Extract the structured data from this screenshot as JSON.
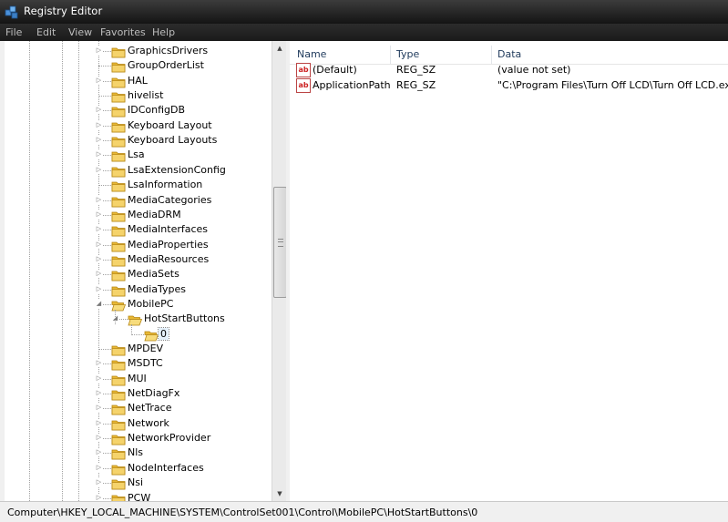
{
  "window": {
    "title": "Registry Editor"
  },
  "menu": [
    "File",
    "Edit",
    "View",
    "Favorites",
    "Help"
  ],
  "tree": {
    "items": [
      {
        "label": "GraphicsDrivers",
        "level": 0,
        "expandable": true
      },
      {
        "label": "GroupOrderList",
        "level": 0,
        "expandable": false
      },
      {
        "label": "HAL",
        "level": 0,
        "expandable": true
      },
      {
        "label": "hivelist",
        "level": 0,
        "expandable": false
      },
      {
        "label": "IDConfigDB",
        "level": 0,
        "expandable": true
      },
      {
        "label": "Keyboard Layout",
        "level": 0,
        "expandable": true
      },
      {
        "label": "Keyboard Layouts",
        "level": 0,
        "expandable": true
      },
      {
        "label": "Lsa",
        "level": 0,
        "expandable": true
      },
      {
        "label": "LsaExtensionConfig",
        "level": 0,
        "expandable": true
      },
      {
        "label": "LsaInformation",
        "level": 0,
        "expandable": false
      },
      {
        "label": "MediaCategories",
        "level": 0,
        "expandable": true
      },
      {
        "label": "MediaDRM",
        "level": 0,
        "expandable": true
      },
      {
        "label": "MediaInterfaces",
        "level": 0,
        "expandable": true
      },
      {
        "label": "MediaProperties",
        "level": 0,
        "expandable": true
      },
      {
        "label": "MediaResources",
        "level": 0,
        "expandable": true
      },
      {
        "label": "MediaSets",
        "level": 0,
        "expandable": true
      },
      {
        "label": "MediaTypes",
        "level": 0,
        "expandable": true
      },
      {
        "label": "MobilePC",
        "level": 0,
        "expandable": true,
        "expanded": true
      },
      {
        "label": "HotStartButtons",
        "level": 1,
        "expandable": true,
        "expanded": true
      },
      {
        "label": "0",
        "level": 2,
        "expandable": false,
        "selected": true
      },
      {
        "label": "MPDEV",
        "level": 0,
        "expandable": false
      },
      {
        "label": "MSDTC",
        "level": 0,
        "expandable": true
      },
      {
        "label": "MUI",
        "level": 0,
        "expandable": true
      },
      {
        "label": "NetDiagFx",
        "level": 0,
        "expandable": true
      },
      {
        "label": "NetTrace",
        "level": 0,
        "expandable": true
      },
      {
        "label": "Network",
        "level": 0,
        "expandable": true
      },
      {
        "label": "NetworkProvider",
        "level": 0,
        "expandable": true
      },
      {
        "label": "Nls",
        "level": 0,
        "expandable": true
      },
      {
        "label": "NodeInterfaces",
        "level": 0,
        "expandable": true
      },
      {
        "label": "Nsi",
        "level": 0,
        "expandable": true
      },
      {
        "label": "PCW",
        "level": 0,
        "expandable": true
      }
    ]
  },
  "list": {
    "columns": [
      "Name",
      "Type",
      "Data"
    ],
    "rows": [
      {
        "name": "(Default)",
        "type": "REG_SZ",
        "data": "(value not set)",
        "icon": "string-value-icon"
      },
      {
        "name": "ApplicationPath",
        "type": "REG_SZ",
        "data": "\"C:\\Program Files\\Turn Off LCD\\Turn Off LCD.exe\"",
        "icon": "string-value-icon"
      }
    ]
  },
  "status": {
    "path": "Computer\\HKEY_LOCAL_MACHINE\\SYSTEM\\ControlSet001\\Control\\MobilePC\\HotStartButtons\\0"
  },
  "colors": {
    "folder": "#e8b835",
    "titlebar": "#1f1f1f",
    "selection": "#e5f1fb"
  }
}
